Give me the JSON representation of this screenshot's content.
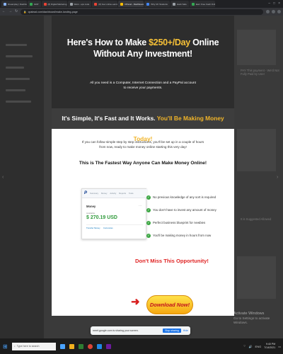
{
  "browser": {
    "tabs": [
      {
        "label": "Dreamplay | Dashboard",
        "favicon_color": "#8ab4f8"
      },
      {
        "label": "GDP",
        "favicon_color": "#34a853"
      },
      {
        "label": "(8) Digital Marketing",
        "favicon_color": "#ea4335"
      },
      {
        "label": "Want - eps code",
        "favicon_color": "#9aa0a6"
      },
      {
        "label": "(8) how online earning",
        "favicon_color": "#ea4335"
      },
      {
        "label": "CPanel - Dashboard",
        "favicon_color": "#fbbc04",
        "active": true
      },
      {
        "label": "Why UK Students",
        "favicon_color": "#4285f4"
      },
      {
        "label": "Hack Safe",
        "favicon_color": "#9aa0a6"
      },
      {
        "label": "Earn Free Cash Online",
        "favicon_color": "#34a853"
      }
    ],
    "url": "cpalead.com/dashboard/make-landing-page"
  },
  "modal": {
    "title_part1": "Here's How to Make ",
    "title_highlight": "$250+/Day",
    "title_part2": " Online",
    "title_line2": "Without Any Investment!",
    "subtitle": "All you need is a Computer, Internet Connection and a PayPal account to receive your payments.",
    "banner_part1": "It's Simple, It's Fast and It Works. ",
    "banner_highlight": "You'll Be Making Money Today!",
    "body": "If you can follow simple step by step instructions, you'll be set up in a couple of hours from now, ready to make money online starting this very day!",
    "headline": "This is The Fastest Way Anyone Can Make Money Online!",
    "paypal": {
      "logo": "P",
      "nav": [
        "Summary",
        "Money",
        "Activity",
        "Reports",
        "Tools"
      ],
      "money_label": "Money",
      "more": "···",
      "available_label": "Available",
      "amount": "$ 270.19 USD",
      "links": [
        "Transfer Money",
        "Currencies"
      ]
    },
    "checks": [
      "No previous knowledge of any sort is required",
      "You don't have to invest any amount of money",
      "Perfect business blueprint for newbies",
      "You'll be making money in hours from now"
    ],
    "dont_miss": "Don't Miss This Opportunity!",
    "cta": "Download Now!"
  },
  "share_bar": {
    "message": "meet.google.com is sharing your screen.",
    "stop": "Stop sharing",
    "hide": "Hide"
  },
  "background": {
    "right_text_1": "PAY This payment - We'd Not Fully Paid by User",
    "right_text_2": "It is Suggested Allowed"
  },
  "activate": {
    "title": "Activate Windows",
    "sub": "Go to Settings to activate Windows."
  },
  "taskbar": {
    "search_placeholder": "Type here to search",
    "time": "9:40 PM",
    "date": "7/14/2021",
    "lang": "ENG"
  }
}
